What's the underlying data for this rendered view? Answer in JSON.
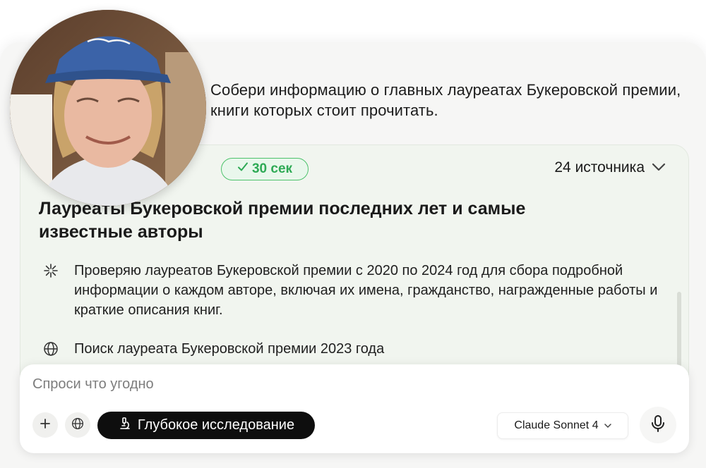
{
  "user_message": "Собери информацию о главных лауреатах Букеровской премии, книги которых стоит прочитать.",
  "research": {
    "status_fragment": "ие",
    "time_badge": "30 сек",
    "time_icon": "check-icon",
    "sources_label": "24 источника",
    "title": "Лауреаты Букеровской премии последних лет и самые известные авторы",
    "steps": [
      {
        "icon": "sparkle-icon",
        "text": "Проверяю лауреатов Букеровской премии с 2020 по 2024 год для сбора подробной информации о каждом авторе, включая их имена, гражданство, награжденные работы и краткие описания книг."
      },
      {
        "icon": "globe-icon",
        "text": "Поиск лауреата Букеровской премии 2023 года"
      }
    ]
  },
  "composer": {
    "placeholder": "Спроси что угодно",
    "deep_research_label": "Глубокое исследование",
    "model_label": "Claude Sonnet 4"
  },
  "colors": {
    "accent_green": "#2eaa55",
    "card_bg": "#f1f5ef",
    "dark_button": "#0e0e0e"
  }
}
